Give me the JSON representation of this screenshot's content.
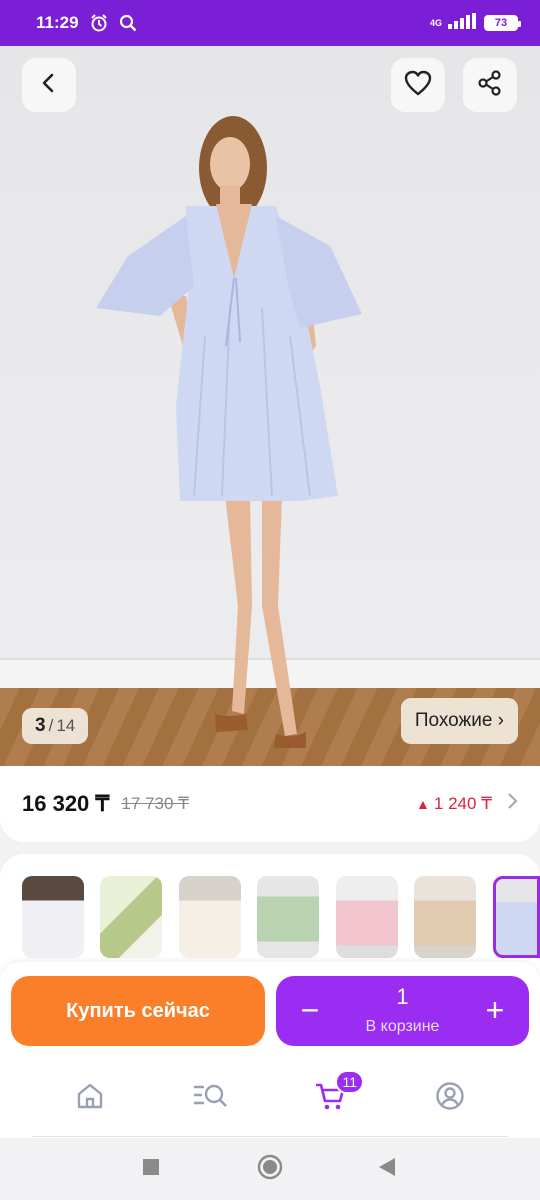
{
  "status_bar": {
    "time": "11:29",
    "network": "4G",
    "battery": "73"
  },
  "gallery": {
    "current": "3",
    "separator": "/",
    "total": "14",
    "similar_label": "Похожие ›"
  },
  "price_info": {
    "price": "16 320 ₸",
    "old_price": "17 730 ₸",
    "difference": "1 240 ₸",
    "difference_arrow": "▲"
  },
  "actions": {
    "buy_now": "Купить сейчас",
    "quantity": "1",
    "in_cart_label": "В корзине",
    "minus": "−",
    "plus": "+"
  },
  "nav": {
    "cart_badge": "11"
  },
  "colors": {
    "brand": "#7b1fd6",
    "cart_purple": "#9b2cf2",
    "buy_orange": "#fb7f2b",
    "price_up": "#e0223d"
  }
}
